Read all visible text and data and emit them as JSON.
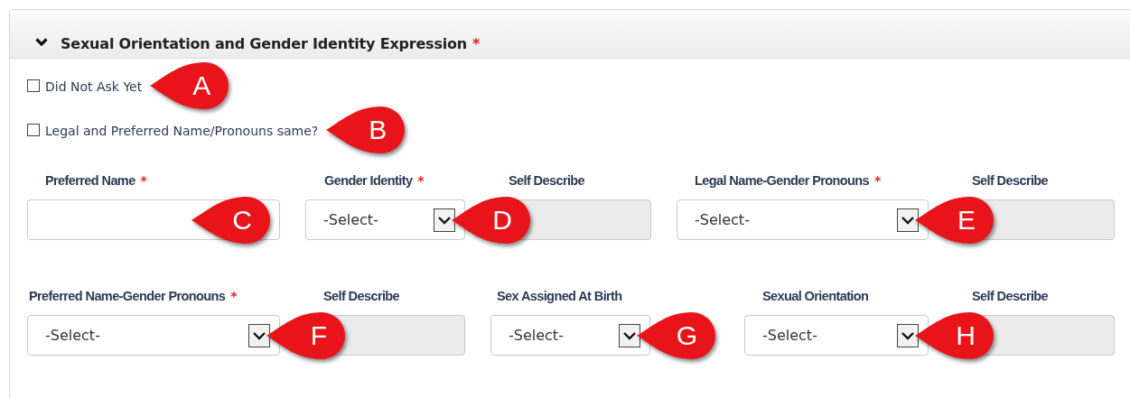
{
  "section": {
    "title": "Sexual Orientation and Gender Identity Expression",
    "asterisk": "*",
    "expanded": true
  },
  "checkboxes": [
    {
      "label": "Did Not Ask Yet",
      "checked": false,
      "callout": "A"
    },
    {
      "label": "Legal and Preferred Name/Pronouns same?",
      "checked": false,
      "callout": "B"
    }
  ],
  "field_rows": [
    [
      {
        "kind": "text",
        "label": "Preferred Name",
        "asterisk": "*",
        "disabled": false,
        "callout": "C"
      },
      {
        "kind": "select",
        "label": "Gender Identity",
        "asterisk": "*",
        "value": "-Select-",
        "callout": "D"
      },
      {
        "kind": "text",
        "label": "Self Describe",
        "disabled": true
      },
      {
        "kind": "select",
        "label": "Legal Name-Gender Pronouns",
        "asterisk": "*",
        "value": "-Select-",
        "callout": "E"
      },
      {
        "kind": "text",
        "label": "Self Describe",
        "disabled": true
      }
    ],
    [
      {
        "kind": "select",
        "label": "Preferred Name-Gender Pronouns",
        "asterisk": "*",
        "value": "-Select-",
        "callout": "F"
      },
      {
        "kind": "text",
        "label": "Self Describe",
        "disabled": true
      },
      {
        "kind": "select",
        "label": "Sex Assigned At Birth",
        "value": "-Select-",
        "callout": "G"
      },
      {
        "kind": "select",
        "label": "Sexual Orientation",
        "value": "-Select-",
        "callout": "H"
      },
      {
        "kind": "text",
        "label": "Self Describe",
        "disabled": true
      }
    ]
  ]
}
